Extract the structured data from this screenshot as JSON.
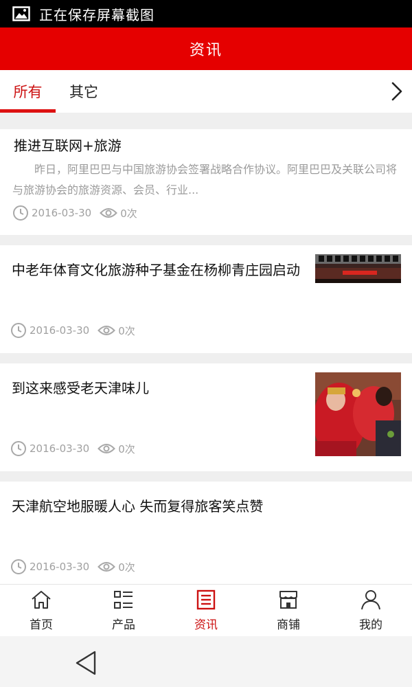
{
  "status_bar": {
    "text": "正在保存屏幕截图",
    "icon": "image-icon"
  },
  "header": {
    "title": "资讯",
    "color": "#e50000"
  },
  "tabs": {
    "items": [
      {
        "label": "所有",
        "active": true
      },
      {
        "label": "其它",
        "active": false
      }
    ],
    "more_icon": "chevron-right-icon"
  },
  "articles": [
    {
      "title": "推进互联网+旅游",
      "summary": "昨日，阿里巴巴与中国旅游协会签署战略合作协议。阿里巴巴及关联公司将与旅游协会的旅游资源、会员、行业...",
      "date": "2016-03-30",
      "views": "0次"
    },
    {
      "title": "中老年体育文化旅游种子基金在杨柳青庄园启动",
      "date": "2016-03-30",
      "views": "0次",
      "image": "event-stage-photo"
    },
    {
      "title": "到这来感受老天津味儿",
      "date": "2016-03-30",
      "views": "0次",
      "image": "traditional-costume-photo"
    },
    {
      "title": "天津航空地服暖人心 失而复得旅客笑点赞",
      "date": "2016-03-30",
      "views": "0次"
    }
  ],
  "bottom_nav": [
    {
      "label": "首页",
      "icon": "home-icon",
      "active": false
    },
    {
      "label": "产品",
      "icon": "list-icon",
      "active": false
    },
    {
      "label": "资讯",
      "icon": "news-icon",
      "active": true
    },
    {
      "label": "商铺",
      "icon": "shop-icon",
      "active": false
    },
    {
      "label": "我的",
      "icon": "user-icon",
      "active": false
    }
  ],
  "accent_color": "#cc1111"
}
